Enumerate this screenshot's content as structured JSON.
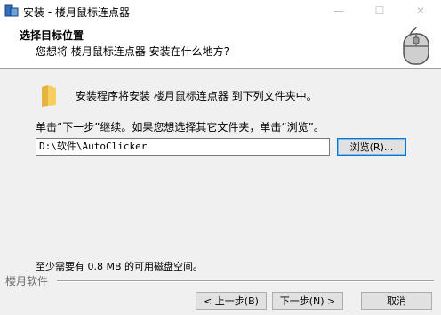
{
  "window": {
    "title": "安装 - 楼月鼠标连点器",
    "min": "—",
    "max": "☐",
    "close": "✕"
  },
  "header": {
    "title": "选择目标位置",
    "subtitle": "您想将 楼月鼠标连点器 安装在什么地方?"
  },
  "main": {
    "info": "安装程序将安装 楼月鼠标连点器 到下列文件夹中。",
    "instruction": "单击“下一步”继续。如果您想选择其它文件夹，单击“浏览”。",
    "path_value": "D:\\软件\\AutoClicker",
    "browse_label": "浏览(R)...",
    "space_required": "至少需要有 0.8 MB 的可用磁盘空间。"
  },
  "footer": {
    "brand": "楼月软件",
    "back_label": "< 上一步(B)",
    "next_label": "下一步(N) >",
    "cancel_label": "取消"
  },
  "icons": {
    "app": "installer-icon",
    "mouse": "mouse-icon",
    "folder": "folder-icon"
  },
  "colors": {
    "folder": "#f2c94c",
    "focus": "#0078d7"
  }
}
